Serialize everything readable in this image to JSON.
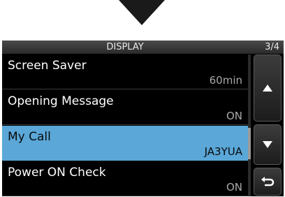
{
  "header": {
    "title": "DISPLAY",
    "page_indicator": "3/4"
  },
  "items": [
    {
      "label": "Screen Saver",
      "value": "60min"
    },
    {
      "label": "Opening Message",
      "value": "ON"
    },
    {
      "label": "My Call",
      "value": "JA3YUA"
    },
    {
      "label": "Power ON Check",
      "value": "ON"
    }
  ],
  "selected_item": "My Call",
  "icons": {
    "top_arrow": "down-arrow-icon",
    "up_button": "up-arrow-icon",
    "down_button": "down-arrow-icon",
    "back_button": "return-arrow-icon"
  },
  "colors": {
    "selected_bg": "#5aa7d8",
    "screen_bg": "#000000"
  }
}
